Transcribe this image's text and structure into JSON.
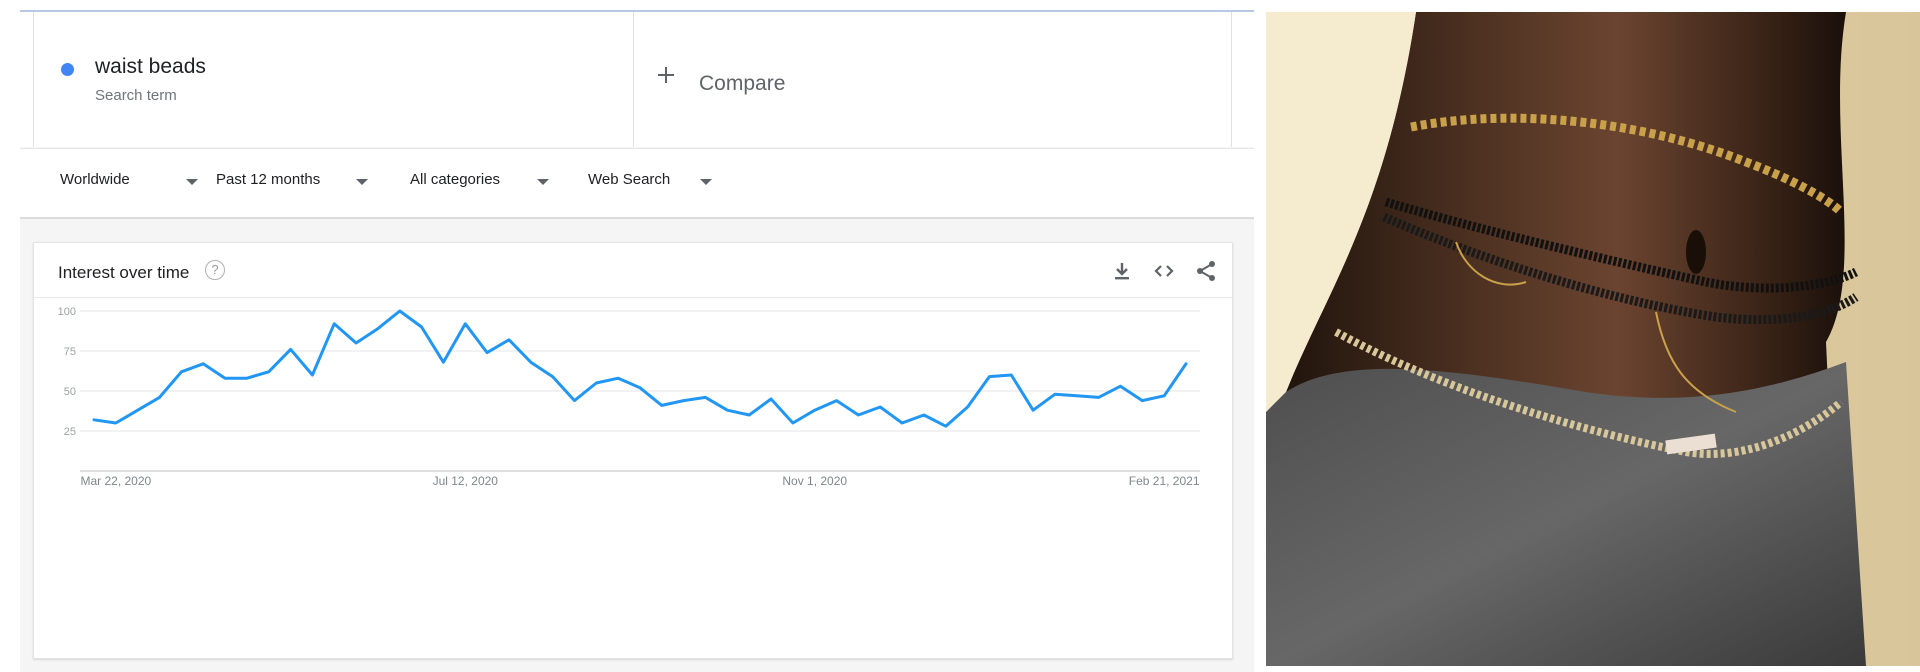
{
  "search_term": {
    "name": "waist beads",
    "type": "Search term",
    "color": "#4285f4"
  },
  "compare": {
    "label": "Compare"
  },
  "filters": [
    {
      "label": "Worldwide"
    },
    {
      "label": "Past 12 months"
    },
    {
      "label": "All categories"
    },
    {
      "label": "Web Search"
    }
  ],
  "chart_card": {
    "title": "Interest over time",
    "help_glyph": "?",
    "tools": [
      "download-icon",
      "embed-code-icon",
      "share-icon"
    ]
  },
  "chart_data": {
    "type": "line",
    "title": "Interest over time",
    "xlabel": "",
    "ylabel": "",
    "ylim": [
      0,
      100
    ],
    "yticks": [
      25,
      50,
      75,
      100
    ],
    "x_tick_labels": [
      "Mar 22, 2020",
      "Jul 12, 2020",
      "Nov 1, 2020",
      "Feb 21, 2021"
    ],
    "x_tick_weeks": [
      1,
      17,
      33,
      49
    ],
    "grid": true,
    "series": [
      {
        "color": "#2196f3",
        "values": [
          32,
          30,
          38,
          46,
          62,
          67,
          58,
          58,
          62,
          76,
          60,
          92,
          80,
          89,
          100,
          90,
          68,
          92,
          74,
          82,
          68,
          59,
          44,
          55,
          58,
          52,
          41,
          44,
          46,
          38,
          35,
          45,
          30,
          38,
          44,
          35,
          40,
          30,
          35,
          28,
          40,
          59,
          60,
          38,
          48,
          47,
          46,
          53,
          44,
          47,
          67
        ]
      }
    ]
  },
  "photo": {
    "description_icon": "photo-image"
  }
}
